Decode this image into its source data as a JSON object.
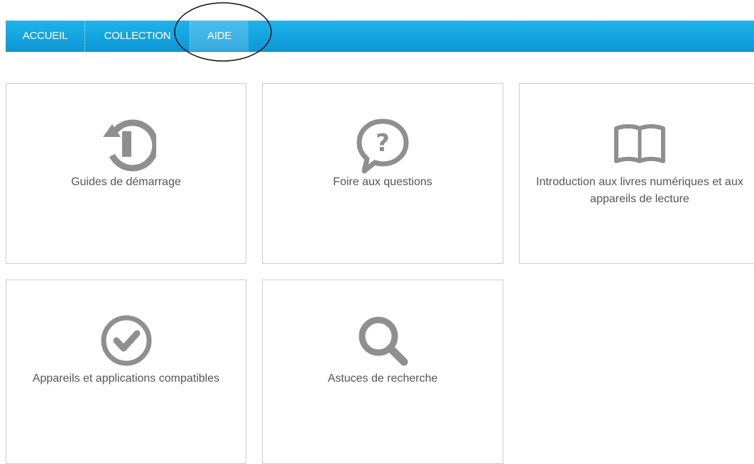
{
  "nav": {
    "items": [
      {
        "label": "ACCUEIL"
      },
      {
        "label": "COLLECTION"
      },
      {
        "label": "AIDE",
        "active": true
      }
    ],
    "color": "#16a6e2"
  },
  "cards": [
    {
      "label": "Guides de démarrage",
      "icon": "history-icon"
    },
    {
      "label": "Foire aux questions",
      "icon": "question-bubble-icon"
    },
    {
      "label": "Introduction aux livres numériques et aux appareils de lecture",
      "icon": "open-book-icon"
    },
    {
      "label": "Appareils et applications compatibles",
      "icon": "check-circle-icon"
    },
    {
      "label": "Astuces de recherche",
      "icon": "search-icon"
    }
  ]
}
